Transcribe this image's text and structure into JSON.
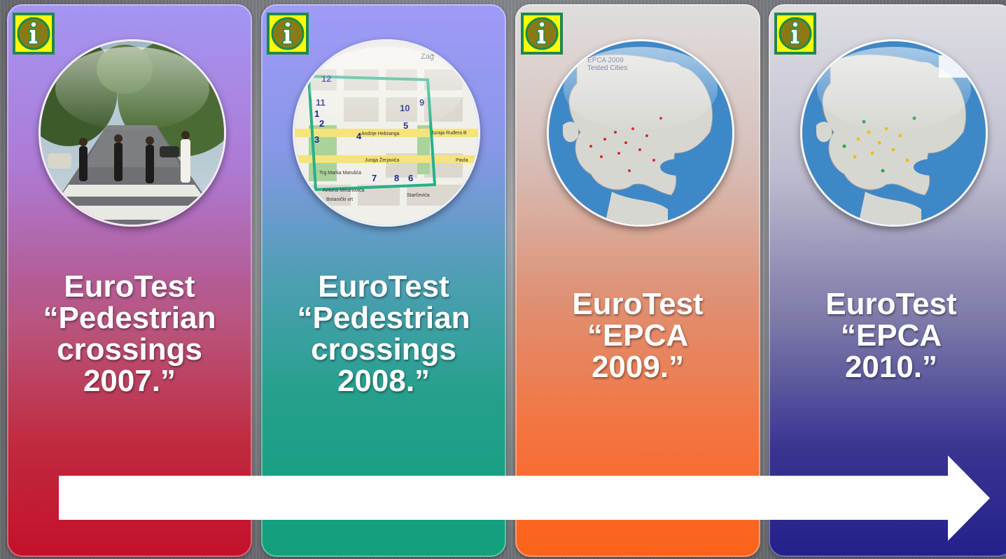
{
  "cards": [
    {
      "title": "EuroTest",
      "line2": "“Pedestrian",
      "line3": "crossings",
      "line4": "2007.”",
      "info_icon": "info-icon",
      "image_icon": "abbey-road-crossing-photo"
    },
    {
      "title": "EuroTest",
      "line2": "“Pedestrian",
      "line3": "crossings",
      "line4": "2008.”",
      "info_icon": "info-icon",
      "image_icon": "zagreb-street-map",
      "map_labels": [
        "Zag",
        "12",
        "11",
        "1",
        "2",
        "3",
        "4",
        "5",
        "10",
        "9",
        "7",
        "8",
        "6",
        "Juraja Žerjavića",
        "Andrije Hebranga",
        "Pavla",
        "Antuna Mihanovića",
        "Botanički vrt",
        "Trg Marka Marulića",
        "Juraja Ruđera B",
        "Starčevića"
      ]
    },
    {
      "title": "EuroTest",
      "line2": "“EPCA",
      "line3": "2009.”",
      "info_icon": "info-icon",
      "image_icon": "europe-map-2009",
      "map_caption_1": "EPCA 2009",
      "map_caption_2": "Tested Cities"
    },
    {
      "title": "EuroTest",
      "line2": "“EPCA",
      "line3": "2010.”",
      "info_icon": "info-icon",
      "image_icon": "europe-map-2010"
    }
  ],
  "arrow_icon": "timeline-arrow",
  "colors": {
    "card1_top": "#8f7ff0",
    "card1_bottom": "#c4102a",
    "card2_top": "#8b84f6",
    "card2_bottom": "#11a07c",
    "card3_top": "#d9d6d6",
    "card3_bottom": "#fb6218",
    "card4_top": "#d6d6dc",
    "card4_bottom": "#23208a",
    "info_bg": "#ffff00",
    "info_border": "#1d8a4a",
    "info_circle": "#8a7a16"
  }
}
